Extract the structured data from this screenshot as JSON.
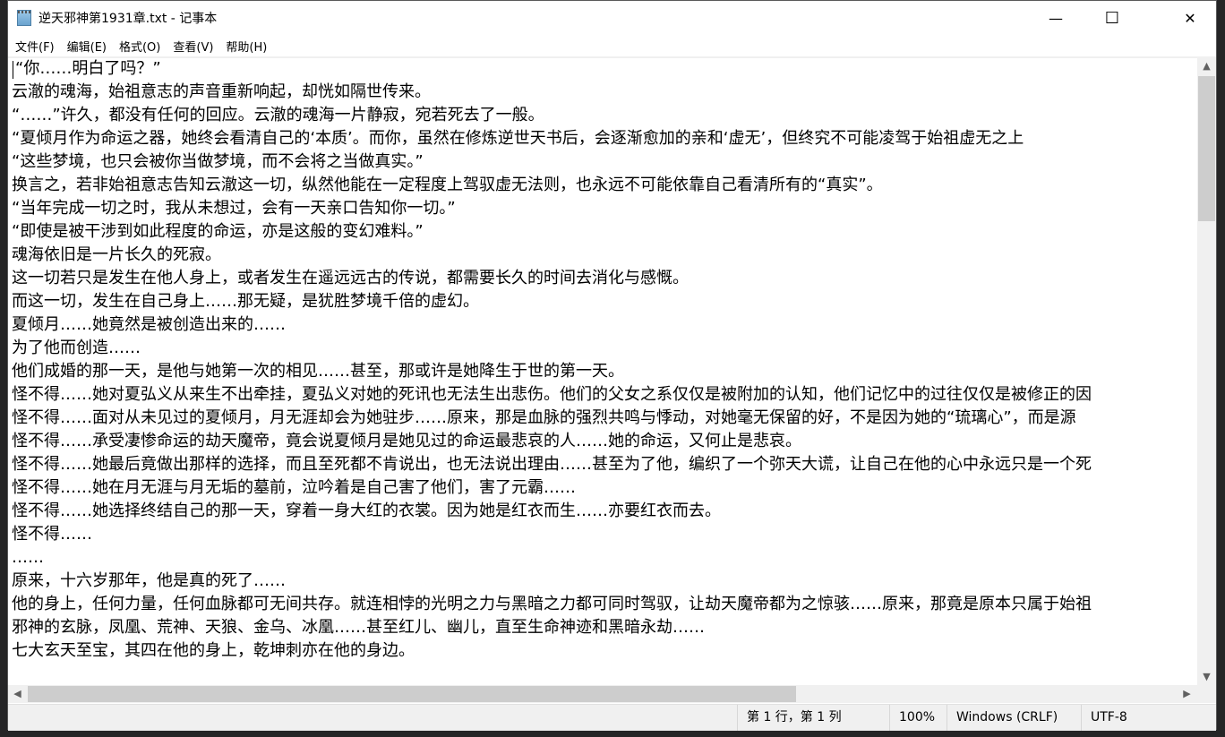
{
  "window": {
    "title": "逆天邪神第1931章.txt - 记事本",
    "minimize": "—",
    "maximize": "☐",
    "close": "✕"
  },
  "menu": [
    "文件(F)",
    "编辑(E)",
    "格式(O)",
    "查看(V)",
    "帮助(H)"
  ],
  "lines": [
    "“你……明白了吗？”",
    "云澈的魂海，始祖意志的声音重新响起，却恍如隔世传来。",
    "“……”许久，都没有任何的回应。云澈的魂海一片静寂，宛若死去了一般。",
    "“夏倾月作为命运之器，她终会看清自己的‘本质’。而你，虽然在修炼逆世天书后，会逐渐愈加的亲和‘虚无’，但终究不可能凌驾于始祖虚无之上",
    "“这些梦境，也只会被你当做梦境，而不会将之当做真实。”",
    "换言之，若非始祖意志告知云澈这一切，纵然他能在一定程度上驾驭虚无法则，也永远不可能依靠自己看清所有的“真实”。",
    "“当年完成一切之时，我从未想过，会有一天亲口告知你一切。”",
    "“即使是被干涉到如此程度的命运，亦是这般的变幻难料。”",
    "魂海依旧是一片长久的死寂。",
    "这一切若只是发生在他人身上，或者发生在遥远远古的传说，都需要长久的时间去消化与感慨。",
    "而这一切，发生在自己身上……那无疑，是犹胜梦境千倍的虚幻。",
    "夏倾月……她竟然是被创造出来的……",
    "为了他而创造……",
    "他们成婚的那一天，是他与她第一次的相见……甚至，那或许是她降生于世的第一天。",
    "怪不得……她对夏弘义从来生不出牵挂，夏弘义对她的死讯也无法生出悲伤。他们的父女之系仅仅是被附加的认知，他们记忆中的过往仅仅是被修正的因",
    "怪不得……面对从未见过的夏倾月，月无涯却会为她驻步……原来，那是血脉的强烈共鸣与悸动，对她毫无保留的好，不是因为她的“琉璃心”，而是源",
    "怪不得……承受凄惨命运的劫天魔帝，竟会说夏倾月是她见过的命运最悲哀的人……她的命运，又何止是悲哀。",
    "怪不得……她最后竟做出那样的选择，而且至死都不肯说出，也无法说出理由……甚至为了他，编织了一个弥天大谎，让自己在他的心中永远只是一个死",
    "怪不得……她在月无涯与月无垢的墓前，泣吟着是自己害了他们，害了元霸……",
    "怪不得……她选择终结自己的那一天，穿着一身大红的衣裳。因为她是红衣而生……亦要红衣而去。",
    "怪不得……",
    "……",
    "原来，十六岁那年，他是真的死了……",
    "他的身上，任何力量，任何血脉都可无间共存。就连相悖的光明之力与黑暗之力都可同时驾驭，让劫天魔帝都为之惊骇……原来，那竟是原本只属于始祖",
    "邪神的玄脉，凤凰、荒神、天狼、金乌、冰凰……甚至红儿、幽儿，直至生命神迹和黑暗永劫……",
    "七大玄天至宝，其四在他的身上，乾坤刺亦在他的身边。"
  ],
  "status": {
    "position": "第 1 行，第 1 列",
    "zoom": "100%",
    "line_ending": "Windows (CRLF)",
    "encoding": "UTF-8"
  }
}
